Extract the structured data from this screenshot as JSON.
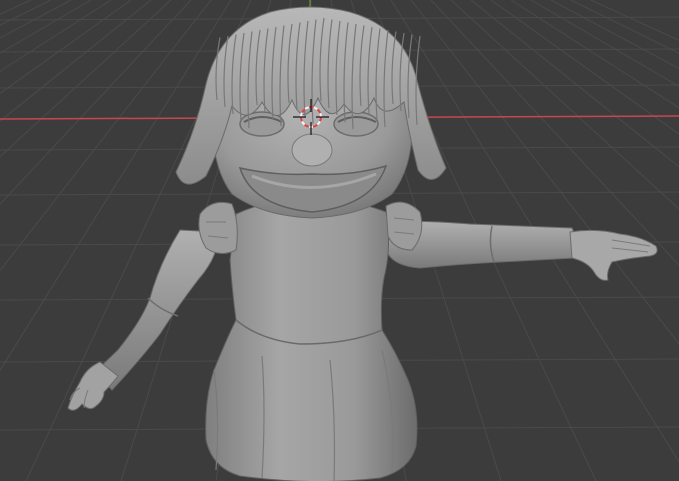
{
  "viewport": {
    "mode": "3d-viewport",
    "shading": "solid",
    "grid": true,
    "background_color": "#3c3c3c",
    "grid_color": "#4a4a4a",
    "x_axis_color": "#c8474f",
    "y_axis_color": "#6a9a3a"
  },
  "model": {
    "object": "character-mesh",
    "pose": "t-pose",
    "material_color": "#9e9e9e",
    "parts": [
      "hair",
      "head",
      "eyes",
      "nose",
      "mouth",
      "dress",
      "left-arm",
      "right-arm",
      "left-hand",
      "right-hand"
    ]
  },
  "cursor": {
    "type": "3d-cursor",
    "ring_colors": [
      "#e04040",
      "#f0f0f0"
    ]
  }
}
